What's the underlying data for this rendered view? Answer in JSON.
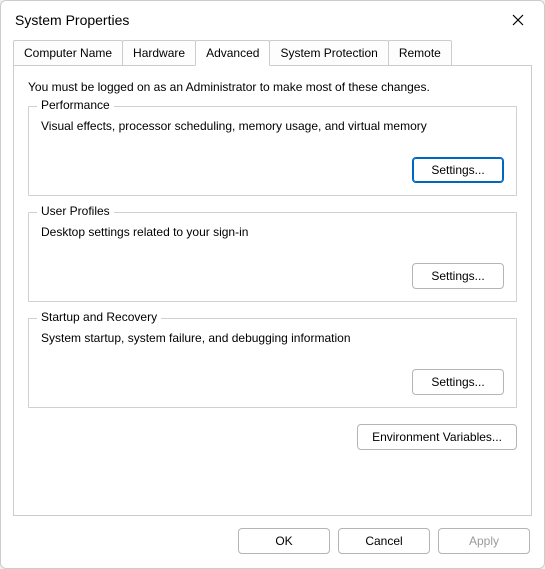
{
  "window": {
    "title": "System Properties"
  },
  "tabs": {
    "computer_name": "Computer Name",
    "hardware": "Hardware",
    "advanced": "Advanced",
    "system_protection": "System Protection",
    "remote": "Remote"
  },
  "advanced": {
    "intro": "You must be logged on as an Administrator to make most of these changes.",
    "performance": {
      "legend": "Performance",
      "desc": "Visual effects, processor scheduling, memory usage, and virtual memory",
      "settings_label": "Settings..."
    },
    "user_profiles": {
      "legend": "User Profiles",
      "desc": "Desktop settings related to your sign-in",
      "settings_label": "Settings..."
    },
    "startup_recovery": {
      "legend": "Startup and Recovery",
      "desc": "System startup, system failure, and debugging information",
      "settings_label": "Settings..."
    },
    "env_vars_label": "Environment Variables..."
  },
  "buttons": {
    "ok": "OK",
    "cancel": "Cancel",
    "apply": "Apply"
  }
}
